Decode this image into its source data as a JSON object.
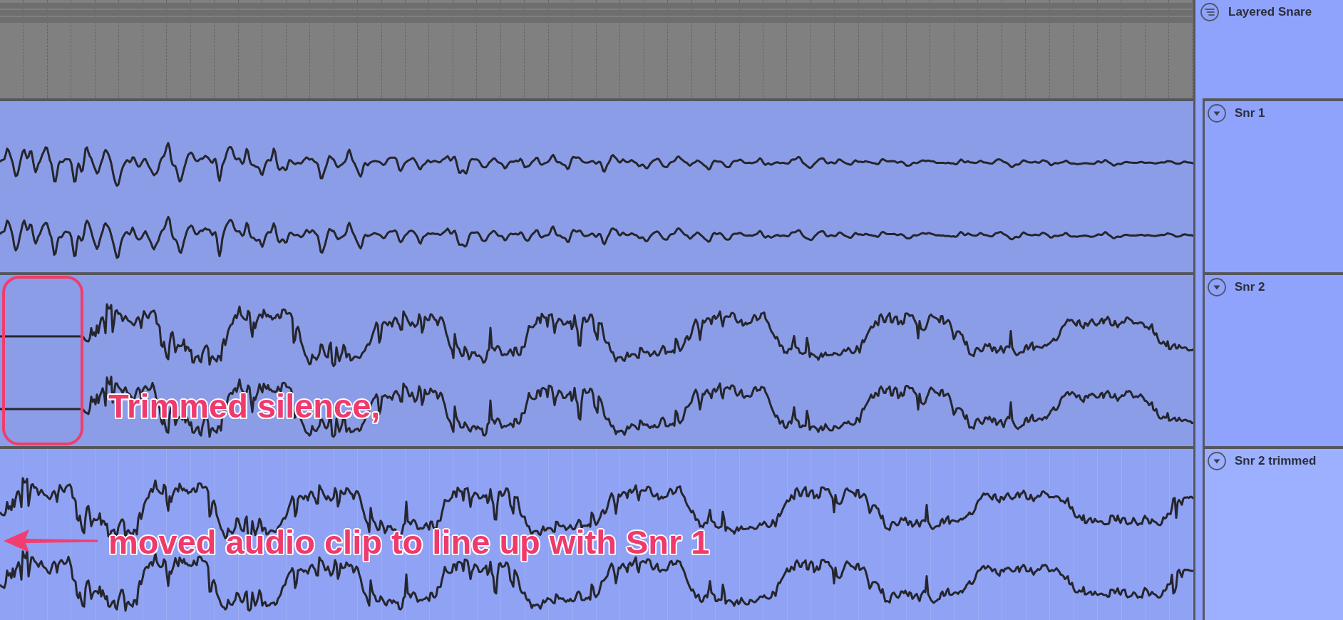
{
  "tracks": [
    {
      "kind": "group",
      "name": "Layered Snare",
      "selected": false
    },
    {
      "kind": "audio",
      "name": "Snr 1",
      "expanded": true,
      "selected": false,
      "clip": {
        "kind": "decaying",
        "leading_silence": false
      }
    },
    {
      "kind": "audio",
      "name": "Snr 2",
      "expanded": true,
      "selected": false,
      "clip": {
        "kind": "oscillating",
        "leading_silence": true
      }
    },
    {
      "kind": "audio",
      "name": "Snr 2 trimmed",
      "expanded": true,
      "selected": true,
      "clip": {
        "kind": "oscillating",
        "leading_silence": false
      }
    }
  ],
  "annotations": [
    "Trimmed silence,",
    "moved audio clip to line up with Snr 1"
  ]
}
